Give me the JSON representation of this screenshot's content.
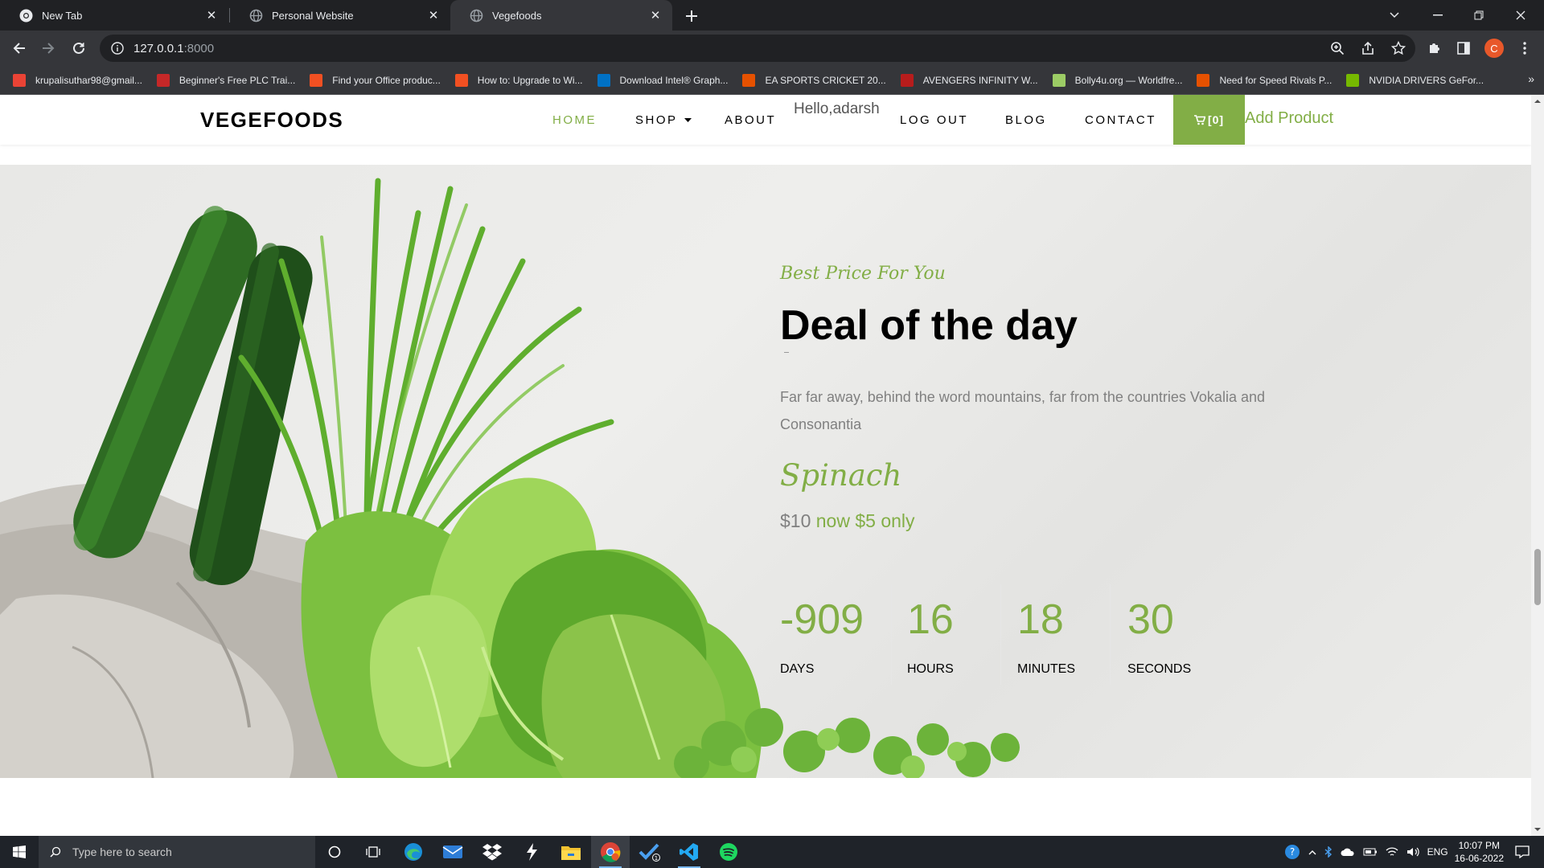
{
  "browser": {
    "tabs": [
      {
        "title": "New Tab",
        "icon": "chrome-icon"
      },
      {
        "title": "Personal Website",
        "icon": "globe-icon"
      },
      {
        "title": "Vegefoods",
        "icon": "globe-icon",
        "active": true
      }
    ],
    "address": {
      "host": "127.0.0.1",
      "port": ":8000"
    },
    "profile_initial": "C",
    "bookmarks": [
      {
        "label": "krupalisuthar98@gmail...",
        "icon": "gmail-icon",
        "color": "#ea4335"
      },
      {
        "label": "Beginner's Free PLC Trai...",
        "icon": "plc-icon",
        "color": "#c62828"
      },
      {
        "label": "Find your Office produc...",
        "icon": "microsoft-icon",
        "color": "#f25022"
      },
      {
        "label": "How to: Upgrade to Wi...",
        "icon": "microsoft-icon",
        "color": "#f25022"
      },
      {
        "label": "Download Intel® Graph...",
        "icon": "intel-icon",
        "color": "#0071c5"
      },
      {
        "label": "EA SPORTS CRICKET 20...",
        "icon": "game-icon",
        "color": "#e65100"
      },
      {
        "label": "AVENGERS INFINITY W...",
        "icon": "hd-icon",
        "color": "#b71c1c"
      },
      {
        "label": "Bolly4u.org — Worldfre...",
        "icon": "bolly-icon",
        "color": "#9ccc65"
      },
      {
        "label": "Need for Speed Rivals P...",
        "icon": "game-icon",
        "color": "#e65100"
      },
      {
        "label": "NVIDIA DRIVERS GeFor...",
        "icon": "nvidia-icon",
        "color": "#76b900"
      }
    ],
    "bookmarks_more": "»"
  },
  "site": {
    "brand": "VEGEFOODS",
    "nav": {
      "home": "HOME",
      "shop": "SHOP",
      "about": "ABOUT",
      "hello": "Hello,adarsh",
      "logout": "LOG OUT",
      "blog": "BLOG",
      "contact": "CONTACT",
      "cart": "[0]",
      "add_product": "Add Product"
    },
    "accent_color": "#82ae46"
  },
  "deal": {
    "subheading": "Best Price For You",
    "title": "Deal of the day",
    "description": "Far far away, behind the word mountains, far from the countries Vokalia and Consonantia",
    "product": "Spinach",
    "price_old": "$10",
    "price_now": "now $5 only",
    "countdown": [
      {
        "value": "-909",
        "label": "DAYS"
      },
      {
        "value": "16",
        "label": "HOURS"
      },
      {
        "value": "18",
        "label": "MINUTES"
      },
      {
        "value": "30",
        "label": "SECONDS"
      }
    ]
  },
  "taskbar": {
    "search_placeholder": "Type here to search",
    "apps": [
      "cortana-icon",
      "task-view-icon",
      "edge-icon",
      "mail-icon",
      "dropbox-icon",
      "winamp-icon",
      "file-explorer-icon",
      "chrome-icon",
      "todo-icon",
      "vscode-icon",
      "spotify-icon"
    ],
    "language": "ENG",
    "time": "10:07 PM",
    "date": "16-06-2022"
  }
}
